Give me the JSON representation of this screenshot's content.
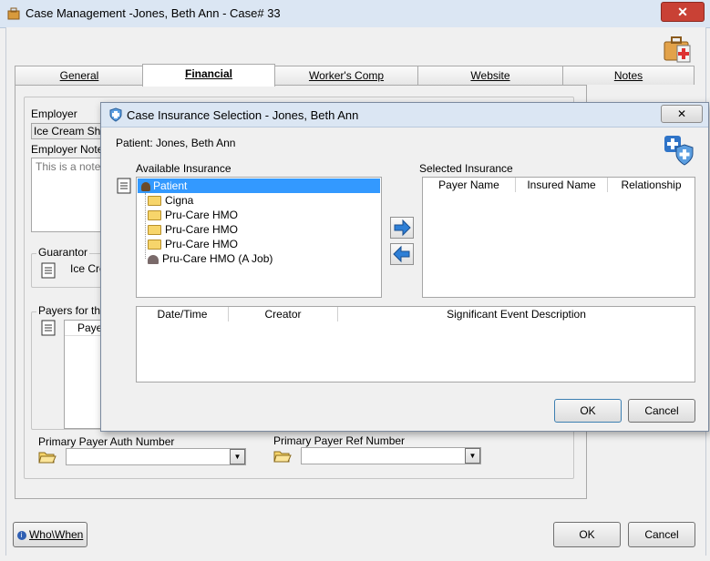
{
  "window": {
    "title": "Case Management -Jones, Beth Ann - Case#  33",
    "close": "✕"
  },
  "tabs": [
    {
      "label": "General"
    },
    {
      "label": "Financial"
    },
    {
      "label": "Worker's Comp"
    },
    {
      "label": "Website"
    },
    {
      "label": "Notes"
    }
  ],
  "financial": {
    "employer_label": "Employer",
    "employer_value": "Ice Cream Shop",
    "employer_notes_label": "Employer Notes",
    "employer_notes_value": "This is a note a",
    "guarantor_label": "Guarantor",
    "guarantor_value": "Ice Cre",
    "payers_label": "Payers for this",
    "payers_column": "Paye",
    "primary_auth_label": "Primary Payer Auth Number",
    "primary_auth_value": "",
    "primary_ref_label": "Primary Payer Ref Number",
    "primary_ref_value": ""
  },
  "footer": {
    "who_when": "Who\\When",
    "ok": "OK",
    "cancel": "Cancel"
  },
  "dialog": {
    "title": "Case Insurance Selection - Jones, Beth Ann",
    "close": "✕",
    "patient_label": "Patient:  Jones, Beth Ann",
    "available_label": "Available Insurance",
    "selected_label": "Selected Insurance",
    "tree": [
      {
        "label": "Patient",
        "kind": "patient",
        "selected": true
      },
      {
        "label": "Cigna",
        "kind": "folder"
      },
      {
        "label": "Pru-Care HMO",
        "kind": "folder"
      },
      {
        "label": "Pru-Care HMO",
        "kind": "folder"
      },
      {
        "label": "Pru-Care HMO",
        "kind": "folder"
      },
      {
        "label": "Pru-Care HMO (A Job)",
        "kind": "job"
      }
    ],
    "selected_columns": [
      "Payer Name",
      "Insured Name",
      "Relationship"
    ],
    "event_columns": [
      "Date/Time",
      "Creator",
      "Significant Event Description"
    ],
    "ok": "OK",
    "cancel": "Cancel"
  },
  "colors": {
    "selection": "#3399ff",
    "arrow_blue": "#2e7fd6"
  }
}
